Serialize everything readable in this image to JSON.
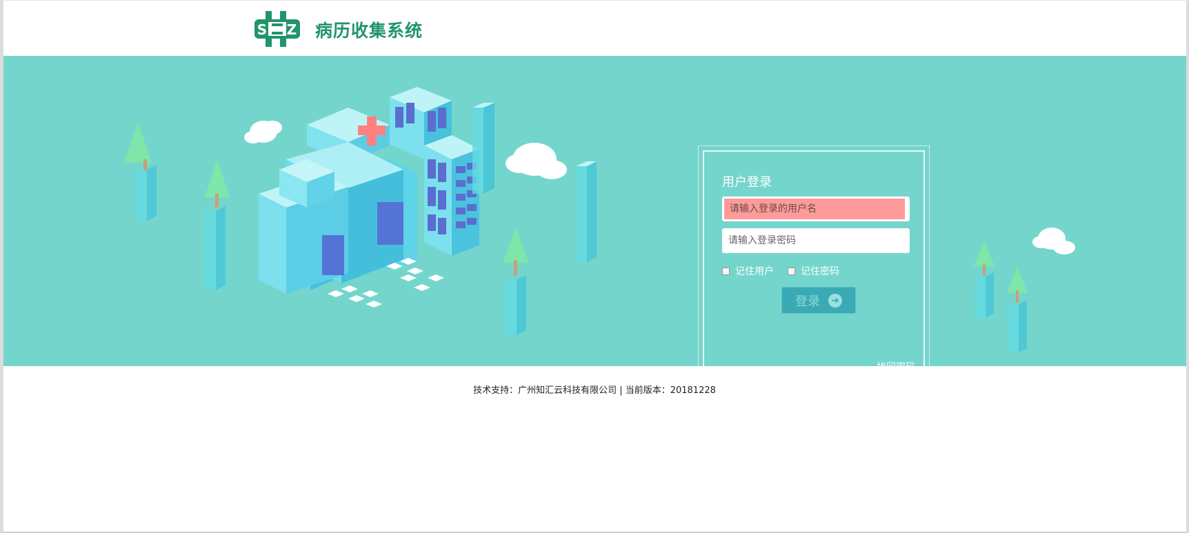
{
  "header": {
    "title": "病历收集系统",
    "logo_text": "S Z"
  },
  "login": {
    "title": "用户登录",
    "username_placeholder": "请输入登录的用户名",
    "password_placeholder": "请输入登录密码",
    "remember_user": "记住用户",
    "remember_password": "记住密码",
    "login_button": "登录",
    "find_password": "找回密码"
  },
  "footer": {
    "text": "技术支持：广州知汇云科技有限公司 | 当前版本：20181228"
  },
  "colors": {
    "brand": "#21956a",
    "banner": "#74d5cc",
    "button": "#3aabb4",
    "username_field": "#ff9a9a"
  }
}
